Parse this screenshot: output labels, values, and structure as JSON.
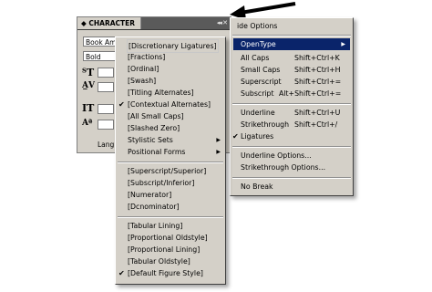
{
  "panel": {
    "title": "CHARACTER",
    "buttons": "◂◂ ✕",
    "menu_button": "▾≡",
    "font_family_value": "Book Am",
    "font_style_value": "Bold",
    "language_label": "Lang"
  },
  "arrow": {
    "color": "#000000"
  },
  "flyout_menu": {
    "items": [
      {
        "label": "Hide Options",
        "partial": "ide Options"
      },
      {
        "label": "OpenType",
        "submenu": true,
        "highlighted": true
      },
      {
        "label": "All Caps",
        "shortcut": "Shift+Ctrl+K"
      },
      {
        "label": "Small Caps",
        "shortcut": "Shift+Ctrl+H"
      },
      {
        "label": "Superscript",
        "shortcut": "Shift+Ctrl+="
      },
      {
        "label": "Subscript",
        "shortcut": "Alt+Shift+Ctrl+="
      },
      {
        "label": "Underline",
        "shortcut": "Shift+Ctrl+U"
      },
      {
        "label": "Strikethrough",
        "shortcut": "Shift+Ctrl+/"
      },
      {
        "label": "Ligatures",
        "checked": true
      },
      {
        "label": "Underline Options..."
      },
      {
        "label": "Strikethrough Options..."
      },
      {
        "label": "No Break"
      }
    ]
  },
  "opentype_submenu": {
    "items": [
      {
        "label": "[Discretionary Ligatures]"
      },
      {
        "label": "[Fractions]"
      },
      {
        "label": "[Ordinal]"
      },
      {
        "label": "[Swash]"
      },
      {
        "label": "[Titling Alternates]"
      },
      {
        "label": "[Contextual Alternates]",
        "checked": true
      },
      {
        "label": "[All Small Caps]"
      },
      {
        "label": "[Slashed Zero]"
      },
      {
        "label": "Stylistic Sets",
        "submenu": true
      },
      {
        "label": "Positional Forms",
        "submenu": true
      },
      {
        "label": "[Superscript/Superior]"
      },
      {
        "label": "[Subscript/Inferior]"
      },
      {
        "label": "[Numerator]"
      },
      {
        "label": "[Dcnominator]"
      },
      {
        "label": "[Tabular Lining]"
      },
      {
        "label": "[Proportional Oldstyle]"
      },
      {
        "label": "[Proportional Lining]"
      },
      {
        "label": "[Tabular Oldstyle]"
      },
      {
        "label": "[Default Figure Style]",
        "checked": true
      }
    ]
  },
  "colors": {
    "menu_bg": "#d4d0c8",
    "highlight": "#0a246a",
    "highlight_text": "#ffffff",
    "panel_bar": "#5a5a5a"
  }
}
